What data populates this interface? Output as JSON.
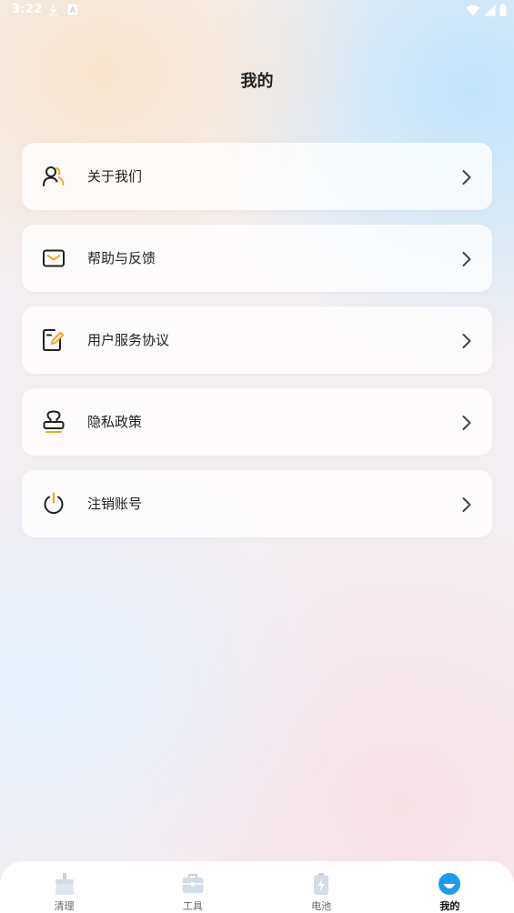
{
  "status_bar": {
    "time": "3:22",
    "left_icons": [
      "download-icon",
      "a-box-icon"
    ],
    "right_icons": [
      "wifi-icon",
      "signal-icon",
      "battery-icon"
    ]
  },
  "header": {
    "title": "我的"
  },
  "menu": {
    "items": [
      {
        "label": "关于我们",
        "icon": "user-group-icon"
      },
      {
        "label": "帮助与反馈",
        "icon": "mail-icon"
      },
      {
        "label": "用户服务协议",
        "icon": "edit-document-icon"
      },
      {
        "label": "隐私政策",
        "icon": "stamp-icon"
      },
      {
        "label": "注销账号",
        "icon": "power-icon"
      }
    ]
  },
  "bottom_nav": {
    "items": [
      {
        "label": "清理",
        "icon": "broom-icon",
        "active": false
      },
      {
        "label": "工具",
        "icon": "toolbox-icon",
        "active": false
      },
      {
        "label": "电池",
        "icon": "battery-charge-icon",
        "active": false
      },
      {
        "label": "我的",
        "icon": "profile-icon",
        "active": true
      }
    ]
  },
  "colors": {
    "accent": "#f5a623",
    "icon_dark": "#222222",
    "nav_active": "#1e9bf0",
    "nav_inactive": "#d3dde8"
  }
}
